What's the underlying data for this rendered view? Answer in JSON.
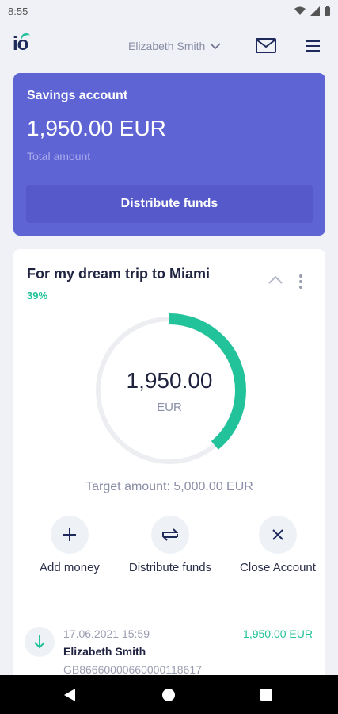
{
  "status_bar": {
    "time": "8:55"
  },
  "header": {
    "logo": "io",
    "user_name": "Elizabeth Smith"
  },
  "savings": {
    "title": "Savings account",
    "amount": "1,950.00 EUR",
    "subtitle": "Total amount",
    "button_label": "Distribute funds"
  },
  "goal": {
    "title": "For my dream trip to Miami",
    "percent": "39%",
    "progress": 0.39,
    "amount": "1,950.00",
    "currency": "EUR",
    "target": "Target amount: 5,000.00 EUR",
    "accent_color": "#22c29a"
  },
  "actions": [
    {
      "label": "Add money",
      "icon": "plus-icon"
    },
    {
      "label": "Distribute funds",
      "icon": "transfer-icon"
    },
    {
      "label": "Close Account",
      "icon": "close-icon"
    }
  ],
  "transaction": {
    "date": "17.06.2021 15:59",
    "name": "Elizabeth Smith",
    "iban": "GB86660000660000118617",
    "amount": "1,950.00 EUR",
    "icon": "arrow-down-icon"
  },
  "colors": {
    "brand": "#5e64d4",
    "accent": "#22c29a",
    "background": "#eff1f6"
  }
}
